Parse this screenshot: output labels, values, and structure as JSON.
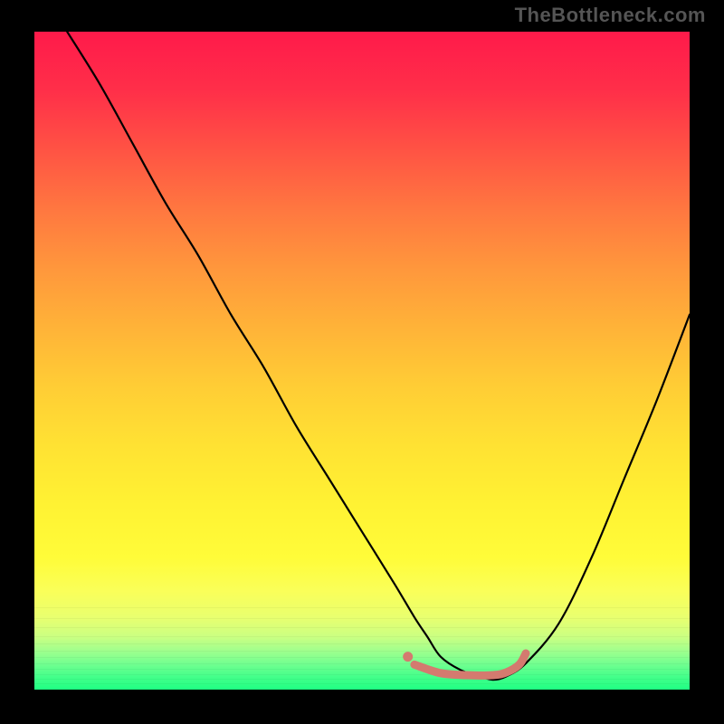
{
  "watermark": "TheBottleneck.com",
  "chart_data": {
    "type": "line",
    "title": "",
    "xlabel": "",
    "ylabel": "",
    "xlim": [
      0,
      100
    ],
    "ylim": [
      0,
      100
    ],
    "grid": false,
    "legend": false,
    "series": [
      {
        "name": "curve",
        "color": "#000000",
        "x": [
          5,
          10,
          15,
          20,
          25,
          30,
          35,
          40,
          45,
          50,
          55,
          58,
          60,
          62,
          65,
          68,
          70,
          72,
          75,
          80,
          85,
          90,
          95,
          100
        ],
        "values": [
          100,
          92,
          83,
          74,
          66,
          57,
          49,
          40,
          32,
          24,
          16,
          11,
          8,
          5,
          3,
          2,
          1.5,
          2,
          4,
          10,
          20,
          32,
          44,
          57
        ]
      },
      {
        "name": "highlight-segment",
        "color": "#d47a6f",
        "x": [
          58,
          62,
          66,
          70,
          72,
          74,
          75
        ],
        "values": [
          3.8,
          2.5,
          2.2,
          2.2,
          2.6,
          3.8,
          5.5
        ]
      },
      {
        "name": "highlight-dot",
        "color": "#d47a6f",
        "type_hint": "marker",
        "x": [
          57
        ],
        "values": [
          5.0
        ]
      }
    ],
    "background_gradient": {
      "top": "#ff1a4a",
      "middle": "#ffe233",
      "bottom": "#1fff83"
    }
  }
}
